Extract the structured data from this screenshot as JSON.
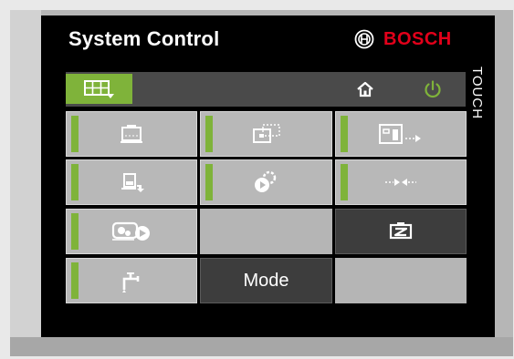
{
  "header": {
    "title": "System Control",
    "brand": "BOSCH",
    "side_label": "TOUCH"
  },
  "toolbar": {
    "menu_icon": "table-menu-icon",
    "home_icon": "home-icon",
    "power_icon": "power-icon"
  },
  "colors": {
    "accent_green": "#7fb33a",
    "brand_red": "#e2001a",
    "tile_gray": "#b8b8b8",
    "tile_dark": "#3d3d3d",
    "toolbar": "#4a4a4a"
  },
  "tiles": [
    {
      "icon": "machine-icon",
      "active": true
    },
    {
      "icon": "module-transfer-icon",
      "active": true
    },
    {
      "icon": "cabinet-arrow-icon",
      "active": true
    },
    {
      "icon": "load-machine-icon",
      "active": true
    },
    {
      "icon": "play-gear-icon",
      "active": true
    },
    {
      "icon": "converge-arrows-icon",
      "active": true
    },
    {
      "icon": "start-cycle-icon",
      "active": true
    },
    {
      "icon": "empty-slot",
      "active": false
    },
    {
      "icon": "battery-status-icon",
      "active": false
    },
    {
      "icon": "water-tap-icon",
      "active": true
    },
    {
      "label": "Mode",
      "active": false
    },
    {
      "icon": "empty-slot",
      "active": false
    }
  ]
}
